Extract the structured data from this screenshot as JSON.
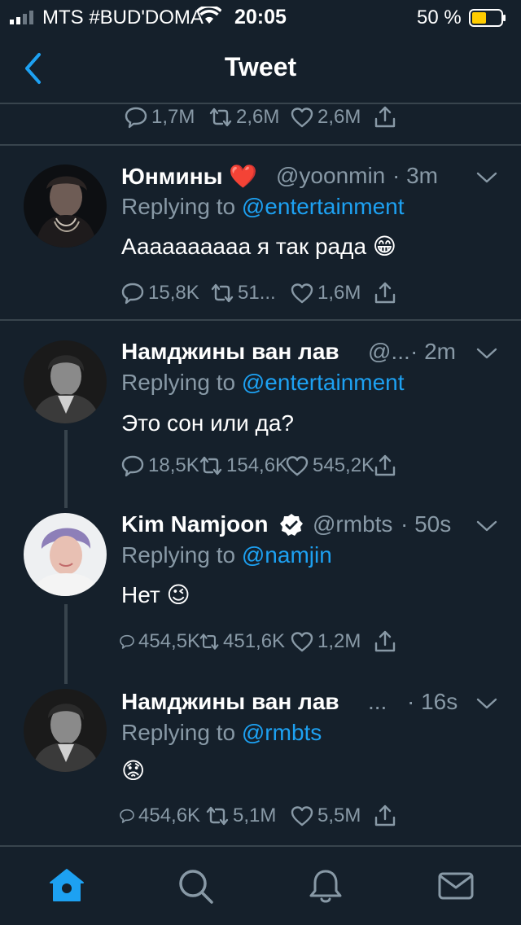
{
  "status_bar": {
    "carrier": "MTS #BUD'DOMA",
    "time": "20:05",
    "battery": "50 %",
    "battery_level": 0.5,
    "icons": [
      "signal-icon",
      "wifi-icon",
      "battery-icon"
    ]
  },
  "header": {
    "title": "Tweet",
    "back_icon": "back-chevron-icon"
  },
  "top_actions": {
    "replies": "1,7M",
    "retweets": "2,6M",
    "likes": "2,6M"
  },
  "tweets": [
    {
      "name": "Юнмины ❤️",
      "handle": "@yoonmin",
      "time": "· 3m",
      "replying_prefix": "Replying to ",
      "replying_to": "@entertainment",
      "text": "Аааааааааа я так рада 😁",
      "replies": "15,8K",
      "retweets": "51...",
      "likes": "1,6M"
    },
    {
      "name": "Намджины ван лав",
      "handle": "@...",
      "time": "· 2m",
      "replying_prefix": "Replying to ",
      "replying_to": "@entertainment",
      "text": "Это сон или да?",
      "replies": "18,5K",
      "retweets": "154,6K",
      "likes": "545,2K"
    },
    {
      "name": "Kim Namjoon",
      "verified": true,
      "handle": "@rmbts",
      "time": "· 50s",
      "replying_prefix": "Replying to ",
      "replying_to": "@namjin",
      "text": "Нет 😉",
      "replies": "454,5K",
      "retweets": "451,6K",
      "likes": "1,2M"
    },
    {
      "name": "Намджины ван лав",
      "handle": "...",
      "time": "· 16s",
      "replying_prefix": "Replying to ",
      "replying_to": "@rmbts",
      "text": "😟",
      "replies": "454,6K",
      "retweets": "5,1M",
      "likes": "5,5M"
    }
  ],
  "tab_bar": {
    "tabs": [
      "home-icon",
      "search-icon",
      "notifications-icon",
      "messages-icon"
    ],
    "active": "home-icon"
  },
  "colors": {
    "background": "#15202b",
    "divider": "#38444d",
    "secondary_text": "#8899a6",
    "link": "#1da1f2",
    "battery_fill": "#ffcc00",
    "verified": "#ffffff"
  }
}
